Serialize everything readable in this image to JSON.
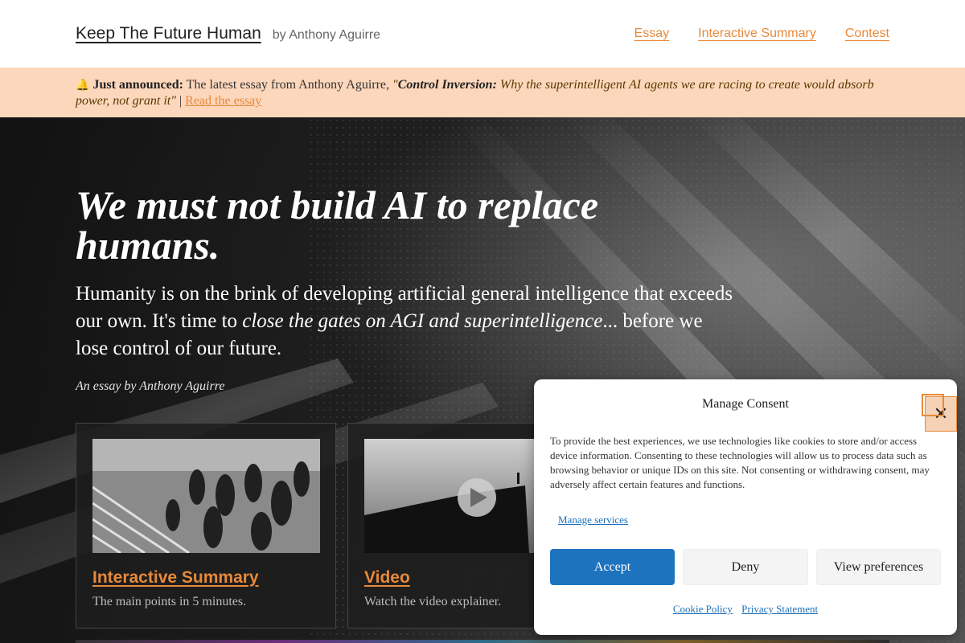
{
  "header": {
    "site_title": "Keep The Future Human",
    "byline": "by Anthony Aguirre",
    "nav": [
      {
        "label": "Essay"
      },
      {
        "label": "Interactive Summary"
      },
      {
        "label": "Contest"
      }
    ]
  },
  "announcement": {
    "icon": "bell-icon",
    "lead": "Just announced:",
    "text": " The latest essay from Anthony Aguirre, ",
    "quote_open": "\"",
    "quote_title": "Control Inversion:",
    "quote_rest": " Why the superintelligent AI agents we are racing to create would absorb power, not grant it",
    "quote_close": "\"",
    "separator": " | ",
    "link": "Read the essay"
  },
  "hero": {
    "title": "We must not build AI to replace humans.",
    "lede_part1": "Humanity is on the brink of developing artificial general intelligence that exceeds our own. It's time to ",
    "lede_emphasis": "close the gates on AGI and superintelligence",
    "lede_part2": "... before we lose control of our future.",
    "credit": "An essay by Anthony Aguirre"
  },
  "cards": [
    {
      "title": "Interactive Summary",
      "description": "The main points in 5 minutes."
    },
    {
      "title": "Video",
      "description": "Watch the video explainer."
    }
  ],
  "consent": {
    "title": "Manage Consent",
    "close_icon": "close-icon",
    "body": "To provide the best experiences, we use technologies like cookies to store and/or access device information. Consenting to these technologies will allow us to process data such as browsing behavior or unique IDs on this site. Not consenting or withdrawing consent, may adversely affect certain features and functions.",
    "manage_services": "Manage services",
    "accept": "Accept",
    "deny": "Deny",
    "view_preferences": "View preferences",
    "cookie_policy": "Cookie Policy",
    "privacy_statement": "Privacy Statement"
  },
  "colors": {
    "accent": "#e8893a",
    "announcement_bg": "#fcd7bc",
    "consent_primary": "#1e73be"
  }
}
